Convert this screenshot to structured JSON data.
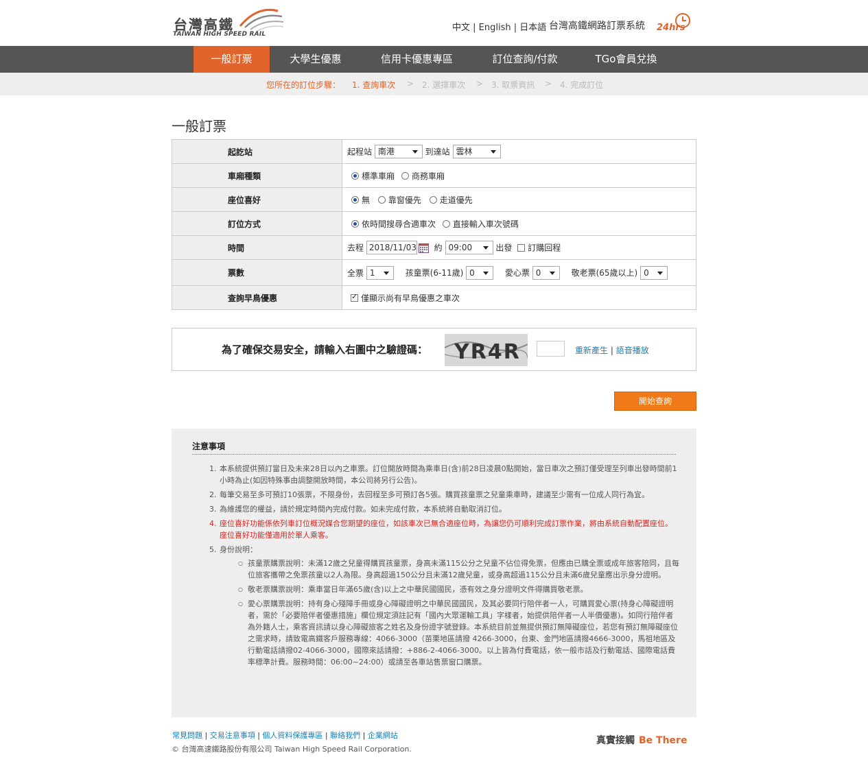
{
  "header": {
    "logo_cn": "台灣高鐵",
    "logo_en": "TAIWAN HIGH SPEED RAIL",
    "languages": [
      "中文",
      "English",
      "日本語"
    ],
    "system_title": "台灣高鐵網路訂票系統",
    "hrs_badge": "24hrs"
  },
  "nav": {
    "items": [
      {
        "label": "一般訂票",
        "active": true
      },
      {
        "label": "大學生優惠",
        "active": false
      },
      {
        "label": "信用卡優惠專區",
        "active": false
      },
      {
        "label": "訂位查詢/付款",
        "active": false
      },
      {
        "label": "TGo會員兌換",
        "active": false
      }
    ]
  },
  "steps": {
    "label": "您所在的訂位步驟：",
    "items": [
      "1. 查詢車次",
      "2. 選擇車次",
      "3. 取票資訊",
      "4. 完成訂位"
    ],
    "separator": ">"
  },
  "page_title": "一般訂票",
  "form": {
    "station": {
      "label": "起訖站",
      "from_label": "起程站",
      "from_value": "南港",
      "to_label": "到達站",
      "to_value": "雲林"
    },
    "car_type": {
      "label": "車廂種類",
      "options": [
        "標準車廂",
        "商務車廂"
      ],
      "selected": "標準車廂"
    },
    "seat_pref": {
      "label": "座位喜好",
      "options": [
        "無",
        "靠窗優先",
        "走道優先"
      ],
      "selected": "無"
    },
    "booking_method": {
      "label": "訂位方式",
      "options": [
        "依時間搜尋合適車次",
        "直接輸入車次號碼"
      ],
      "selected": "依時間搜尋合適車次"
    },
    "time": {
      "label": "時間",
      "outbound_label": "去程",
      "date": "2018/11/03",
      "approx_label": "約",
      "time_value": "09:00",
      "depart_label": "出發",
      "return_label": "訂購回程"
    },
    "tickets": {
      "label": "票數",
      "adult_label": "全票",
      "adult_value": "1",
      "child_label": "孩童票(6-11歲)",
      "child_value": "0",
      "disabled_label": "愛心票",
      "disabled_value": "0",
      "senior_label": "敬老票(65歲以上)",
      "senior_value": "0"
    },
    "early_bird": {
      "label": "查詢早鳥優惠",
      "checkbox_label": "僅顯示尚有早鳥優惠之車次"
    }
  },
  "captcha": {
    "prompt": "為了確保交易安全，請輸入右圖中之驗證碼：",
    "image_text": "YR4R",
    "regenerate_label": "重新產生",
    "audio_label": "語音播放"
  },
  "search_button": "開始查詢",
  "notes": {
    "title": "注意事項",
    "items": [
      "本系統提供預訂當日及未來28日以內之車票。訂位開放時間為乘車日(含)前28日凌晨0點開始，當日車次之預訂僅受理至列車出發時間前1小時為止(如因特殊事由調整開放時間，本公司將另行公告)。",
      "每筆交易至多可預訂10張票，不限身份，去回程至多可預訂各5張。購買孩童票之兒童乘車時，建議至少需有一位成人同行為宜。",
      "為維護您的權益，請於規定時間內完成付款。如未完成付款，本系統將自動取消訂位。",
      "座位喜好功能係依列車訂位概況媒合您期望的座位，如該車次已無合適座位時，為讓您仍可順利完成訂票作業，將由系統自動配置座位。座位喜好功能僅適用於單人乘客。",
      "身份說明："
    ],
    "sub_items": [
      "孩童票購票說明：未滿12歲之兒童得購買孩童票，身高未滿115公分之兒童不佔位得免票，但應由已購全票或成年旅客陪同，且每位旅客攜帶之免票孩童以2人為限。身高超過150公分且未滿12歲兒童，或身高超過115公分且未滿6歲兒童應出示身分證明。",
      "敬老票購票說明：乘車當日年滿65歲(含)以上之中華民國國民，憑有效之身分證明文件得購買敬老票。",
      "愛心票購票說明：持有身心殘障手冊或身心障礙證明之中華民國國民，及其必要同行陪伴者一人，可購買愛心票(持身心障礙證明者，需於「必要陪伴者優惠措施」欄位規定須註記有「國內大眾運輸工具」字樣者，始提供陪伴者一人半價優惠)。如同行陪伴者為外籍人士，乘客資訊請以身心障礙旅客之姓名及身份證字號登錄。本系統目前並無提供預訂無障礙座位，若您有預訂無障礙座位之需求時，請致電高鐵客戶服務專線：4066-3000（苗栗地區請撥 4266-3000，台東、金門地區請撥4666-3000，馬祖地區及行動電話請撥02-4066-3000，國際來話請撥：+886-2-4066-3000。以上皆為付費電話，依一般市話及行動電話、國際電話費率標準計費。服務時間：06:00~24:00）或請至各車站售票窗口購票。"
    ]
  },
  "footer": {
    "links": [
      "常見問題",
      "交易注意事項",
      "個人資料保護專區",
      "聯絡我們",
      "企業網站"
    ],
    "copyright": "© 台灣高速鐵路股份有限公司 Taiwan High Speed Rail Corporation.",
    "slogan_cn": "真實接觸",
    "slogan_en": "Be There"
  },
  "colors": {
    "accent": "#e0642b",
    "nav_bg": "#555555",
    "button": "#f07a1a",
    "link": "#1a7fb5",
    "warning": "#d9251d"
  }
}
